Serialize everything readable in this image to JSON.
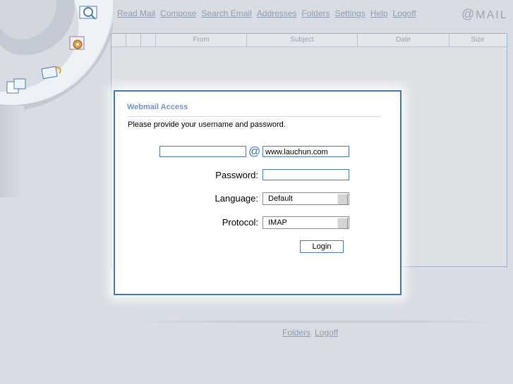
{
  "nav": {
    "items": [
      "Read Mail",
      "Compose",
      "Search Email",
      "Addresses",
      "Folders",
      "Settings",
      "Help",
      "Logoff"
    ]
  },
  "brand": {
    "prefix": "@",
    "text": "MAIL"
  },
  "maillist": {
    "columns": [
      "From",
      "Subject",
      "Date",
      "Size"
    ]
  },
  "dialog": {
    "title": "Webmail Access",
    "instruction": "Please provide your username and password.",
    "username": {
      "value": "",
      "at": "@",
      "domain": "www.lauchun.com"
    },
    "password_label": "Password:",
    "language_label": "Language:",
    "language_value": "Default",
    "protocol_label": "Protocol:",
    "protocol_value": "IMAP",
    "login_label": "Login"
  },
  "footer": {
    "items": [
      "Folders",
      "Logoff"
    ]
  },
  "colors": {
    "accent": "#3d78c2",
    "link": "#8c9db3",
    "background": "#d9dde3"
  }
}
